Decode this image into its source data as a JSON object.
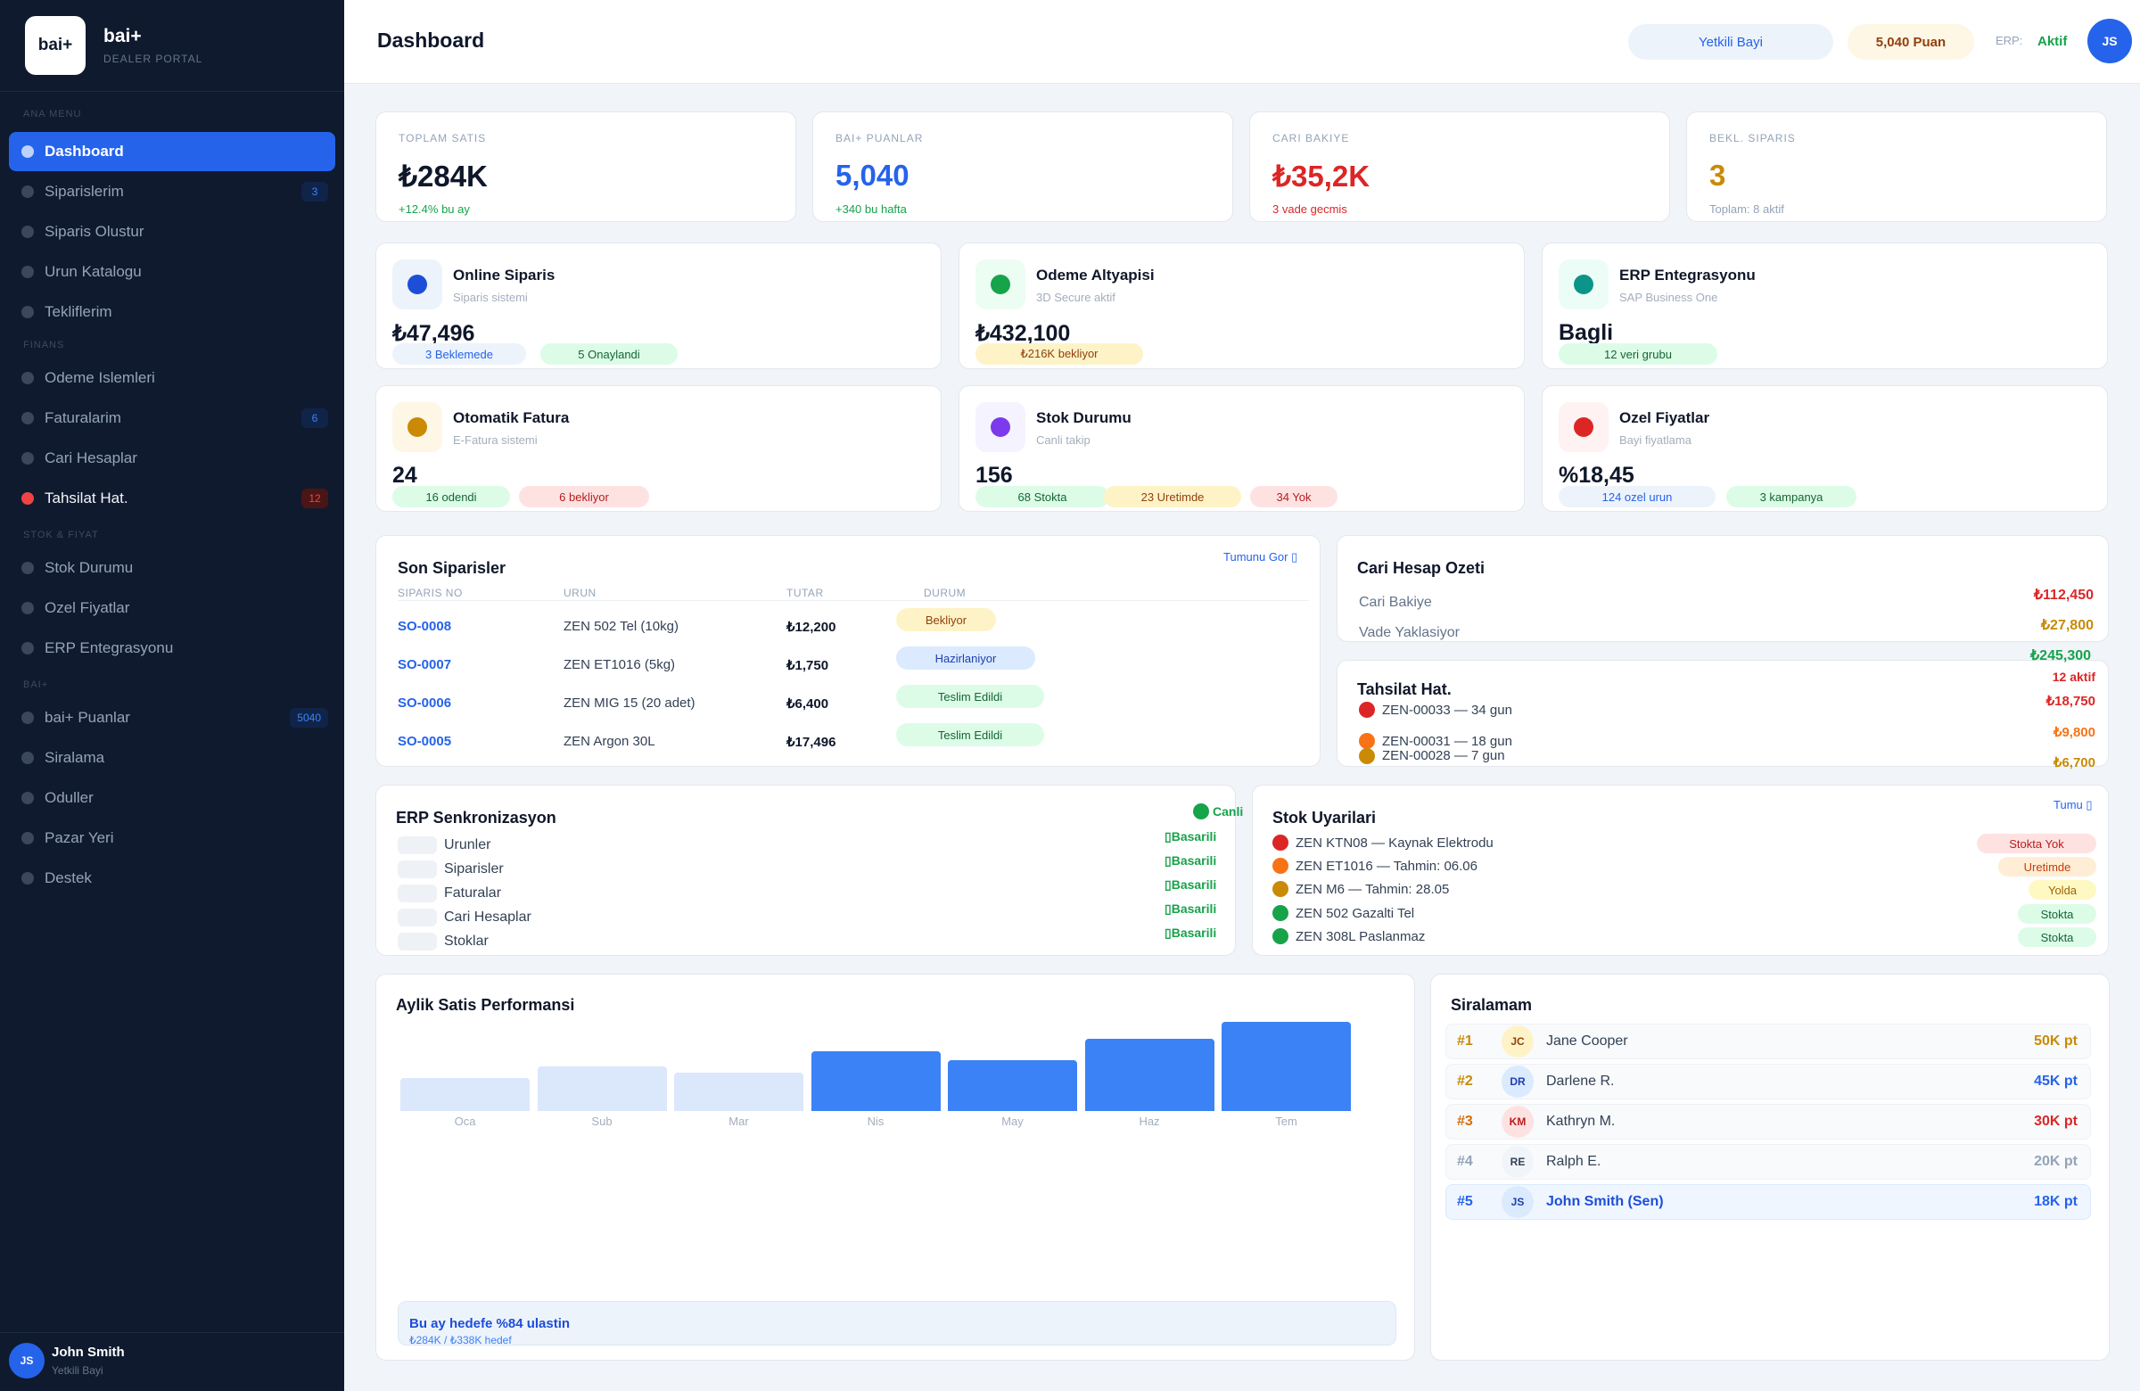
{
  "brand": {
    "logo_text": "bai+",
    "name": "bai+",
    "subtitle": "DEALER PORTAL"
  },
  "sidebar": {
    "sections": [
      {
        "label": "ANA MENU"
      },
      {
        "label": "FINANS"
      },
      {
        "label": "STOK & FIYAT"
      },
      {
        "label": "BAI+"
      }
    ],
    "items": [
      {
        "label": "Dashboard"
      },
      {
        "label": "Siparislerim",
        "badge": "3"
      },
      {
        "label": "Siparis Olustur"
      },
      {
        "label": "Urun Katalogu"
      },
      {
        "label": "Tekliflerim"
      },
      {
        "label": "Odeme Islemleri"
      },
      {
        "label": "Faturalarim",
        "badge": "6"
      },
      {
        "label": "Cari Hesaplar"
      },
      {
        "label": "Tahsilat Hat.",
        "badge": "12"
      },
      {
        "label": "Stok Durumu"
      },
      {
        "label": "Ozel Fiyatlar"
      },
      {
        "label": "ERP Entegrasyonu"
      },
      {
        "label": "bai+ Puanlar",
        "badge": "5040"
      },
      {
        "label": "Siralama"
      },
      {
        "label": "Oduller"
      },
      {
        "label": "Pazar Yeri"
      },
      {
        "label": "Destek"
      }
    ],
    "user": {
      "initials": "JS",
      "name": "John Smith",
      "role": "Yetkili Bayi"
    }
  },
  "header": {
    "title": "Dashboard",
    "role_pill": "Yetkili Bayi",
    "points_pill": "5,040 Puan",
    "erp_label": "ERP:",
    "erp_status": "Aktif",
    "avatar": "JS"
  },
  "stats": [
    {
      "label": "TOPLAM SATIS",
      "value": "₺284K",
      "sub": "+12.4% bu ay"
    },
    {
      "label": "BAI+ PUANLAR",
      "value": "5,040",
      "sub": "+340 bu hafta"
    },
    {
      "label": "CARI BAKIYE",
      "value": "₺35,2K",
      "sub": "3 vade gecmis"
    },
    {
      "label": "BEKL. SIPARIS",
      "value": "3",
      "sub": "Toplam: 8 aktif"
    }
  ],
  "modules": [
    {
      "title": "Online Siparis",
      "sub": "Siparis sistemi",
      "value": "₺47,496",
      "tags": [
        "3 Beklemede",
        "5 Onaylandi"
      ]
    },
    {
      "title": "Odeme Altyapisi",
      "sub": "3D Secure aktif",
      "value": "₺432,100",
      "tags": [
        "₺216K bekliyor"
      ]
    },
    {
      "title": "ERP Entegrasyonu",
      "sub": "SAP Business One",
      "value": "Bagli",
      "tags": [
        "12 veri grubu"
      ]
    },
    {
      "title": "Otomatik Fatura",
      "sub": "E-Fatura sistemi",
      "value": "24",
      "tags": [
        "16 odendi",
        "6 bekliyor"
      ]
    },
    {
      "title": "Stok Durumu",
      "sub": "Canli takip",
      "value": "156",
      "tags": [
        "68 Stokta",
        "23 Uretimde",
        "34 Yok"
      ]
    },
    {
      "title": "Ozel Fiyatlar",
      "sub": "Bayi fiyatlama",
      "value": "%18,45",
      "tags": [
        "124 ozel urun",
        "3 kampanya"
      ]
    }
  ],
  "orders": {
    "title": "Son Siparisler",
    "link": "Tumunu Gor ▯",
    "columns": [
      "SIPARIS NO",
      "URUN",
      "TUTAR",
      "DURUM"
    ],
    "rows": [
      {
        "id": "SO-0008",
        "product": "ZEN 502 Tel (10kg)",
        "amount": "₺12,200",
        "status": "Bekliyor"
      },
      {
        "id": "SO-0007",
        "product": "ZEN ET1016 (5kg)",
        "amount": "₺1,750",
        "status": "Hazirlaniyor"
      },
      {
        "id": "SO-0006",
        "product": "ZEN MIG 15 (20 adet)",
        "amount": "₺6,400",
        "status": "Teslim Edildi"
      },
      {
        "id": "SO-0005",
        "product": "ZEN Argon 30L",
        "amount": "₺17,496",
        "status": "Teslim Edildi"
      }
    ]
  },
  "cari": {
    "title": "Cari Hesap Ozeti",
    "rows": [
      {
        "label": "Cari Bakiye",
        "amount": "₺112,450"
      },
      {
        "label": "Vade Yaklasiyor",
        "amount": "₺27,800"
      }
    ],
    "overflow_amount": "₺245,300"
  },
  "tahsilat": {
    "title": "Tahsilat Hat.",
    "count": "12 aktif",
    "rows": [
      {
        "label": "ZEN-00033 — 34 gun",
        "amount": "₺18,750"
      },
      {
        "label": "ZEN-00031 — 18 gun",
        "amount": "₺9,800"
      },
      {
        "label": "ZEN-00028 — 7 gun",
        "amount": "₺6,700"
      }
    ]
  },
  "erp_sync": {
    "title": "ERP Senkronizasyon",
    "live": "Canli",
    "rows": [
      {
        "label": "Urunler",
        "status": "▯Basarili"
      },
      {
        "label": "Siparisler",
        "status": "▯Basarili"
      },
      {
        "label": "Faturalar",
        "status": "▯Basarili"
      },
      {
        "label": "Cari Hesaplar",
        "status": "▯Basarili"
      },
      {
        "label": "Stoklar",
        "status": "▯Basarili"
      }
    ]
  },
  "stock_alerts": {
    "title": "Stok Uyarilari",
    "link": "Tumu ▯",
    "rows": [
      {
        "label": "ZEN KTN08 — Kaynak Elektrodu",
        "status": "Stokta Yok"
      },
      {
        "label": "ZEN ET1016 — Tahmin: 06.06",
        "status": "Uretimde"
      },
      {
        "label": "ZEN M6 — Tahmin: 28.05",
        "status": "Yolda"
      },
      {
        "label": "ZEN 502 Gazalti Tel",
        "status": "Stokta"
      },
      {
        "label": "ZEN 308L Paslanmaz",
        "status": "Stokta"
      }
    ]
  },
  "performance": {
    "title": "Aylik Satis Performansi",
    "goal_title": "Bu ay hedefe %84 ulastin",
    "goal_sub": "₺284K / ₺338K hedef"
  },
  "chart_data": {
    "type": "bar",
    "categories": [
      "Oca",
      "Sub",
      "Mar",
      "Nis",
      "May",
      "Haz",
      "Tem"
    ],
    "values": [
      37,
      50,
      43,
      67,
      57,
      81,
      100
    ],
    "highlighted": [
      false,
      false,
      false,
      true,
      true,
      true,
      true
    ],
    "colors": {
      "past": "#dbe7fb",
      "recent": "#3b82f6"
    }
  },
  "ranking": {
    "title": "Siralamam",
    "rows": [
      {
        "rank": "#1",
        "initials": "JC",
        "name": "Jane Cooper",
        "points": "50K pt"
      },
      {
        "rank": "#2",
        "initials": "DR",
        "name": "Darlene R.",
        "points": "45K pt"
      },
      {
        "rank": "#3",
        "initials": "KM",
        "name": "Kathryn M.",
        "points": "30K pt"
      },
      {
        "rank": "#4",
        "initials": "RE",
        "name": "Ralph E.",
        "points": "20K pt"
      },
      {
        "rank": "#5",
        "initials": "JS",
        "name": "John Smith (Sen)",
        "points": "18K pt"
      }
    ]
  }
}
